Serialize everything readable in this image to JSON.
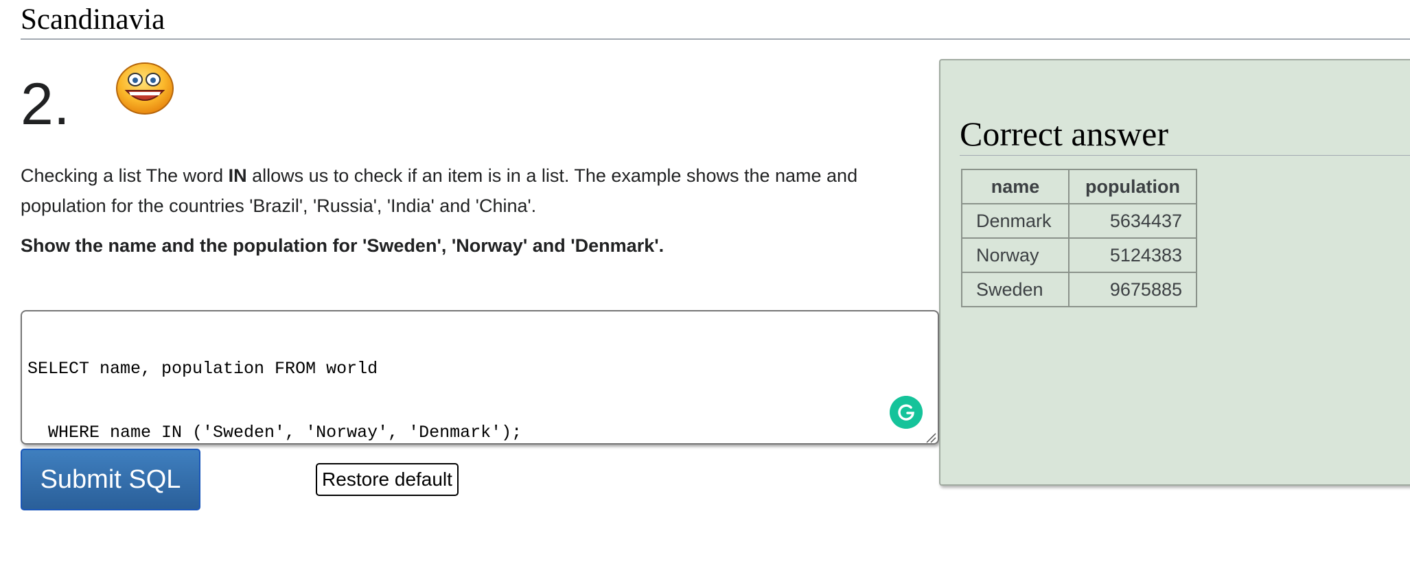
{
  "section": {
    "title": "Scandinavia"
  },
  "question": {
    "number": "2.",
    "description_prefix": "Checking a list The word ",
    "description_bold": "IN",
    "description_suffix": " allows us to check if an item is in a list. The example shows the name and population for the countries 'Brazil', 'Russia', 'India' and 'China'.",
    "task": "Show the name and the population for 'Sweden', 'Norway' and 'Denmark'."
  },
  "editor": {
    "lines": [
      "SELECT name, population FROM world",
      "  WHERE name IN ('Sweden', 'Norway', 'Denmark');"
    ]
  },
  "buttons": {
    "submit_label": "Submit SQL",
    "restore_label": "Restore default"
  },
  "answer": {
    "title": "Correct answer",
    "columns": [
      "name",
      "population"
    ],
    "rows": [
      {
        "name": "Denmark",
        "population": "5634437"
      },
      {
        "name": "Norway",
        "population": "5124383"
      },
      {
        "name": "Sweden",
        "population": "9675885"
      }
    ]
  },
  "colors": {
    "submit_button": "#2f6aa8",
    "answer_panel_bg": "#d9e5d9",
    "grammarly_badge": "#15c39a",
    "smiley_face": "#f7a21b"
  },
  "icons": {
    "smiley": "smiley-face-icon",
    "grammarly": "grammarly-icon",
    "resize": "resize-handle-icon"
  }
}
